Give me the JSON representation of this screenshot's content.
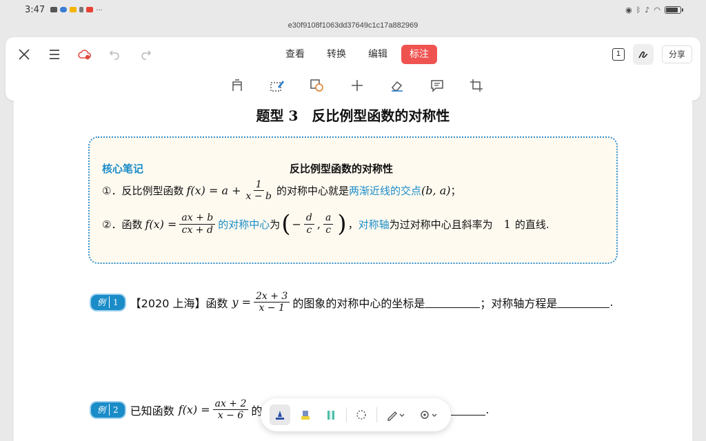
{
  "status_bar": {
    "time": "3:47",
    "battery_level": 0.9
  },
  "file_name": "e30f9108f1063dd37649c1c17a882969",
  "toolbar": {
    "tabs": [
      {
        "label": "查看",
        "active": false
      },
      {
        "label": "转换",
        "active": false
      },
      {
        "label": "编辑",
        "active": false
      },
      {
        "label": "标注",
        "active": true
      }
    ],
    "page_indicator": "1",
    "share_label": "分享",
    "accent_color": "#ef5350"
  },
  "document": {
    "title": "题型 3　反比例型函数的对称性",
    "note": {
      "label": "核心笔记",
      "heading": "反比例型函数的对称性",
      "item1": {
        "prefix": "①．反比例型函数",
        "fx": "f(x) = a +",
        "frac_num": "1",
        "frac_den": "x − b",
        "mid": "的对称中心就是",
        "highlight": "两渐近线的交点",
        "point": "(b, a)",
        "end": "；"
      },
      "item2": {
        "prefix": "②．函数",
        "fx": "f(x) =",
        "frac_num": "ax + b",
        "frac_den": "cx + d",
        "highlight1": "的对称中心",
        "mid1": "为",
        "minus": "−",
        "c1_num": "d",
        "c1_den": "c",
        "comma": ",",
        "c2_num": "a",
        "c2_den": "c",
        "sep": "，",
        "highlight2": "对称轴",
        "mid2": "为过对称中心且斜率为",
        "slope": "1",
        "end": "的直线."
      }
    },
    "example1": {
      "badge_a": "例",
      "badge_b": "1",
      "source": "【2020 上海】函数",
      "y_eq": "y =",
      "frac_num": "2x + 3",
      "frac_den": "x − 1",
      "text1": "的图象的对称中心的坐标是",
      "text2": "；对称轴方程是",
      "end": "."
    },
    "example2": {
      "badge_a": "例",
      "badge_b": "2",
      "text": "已知函数",
      "fx": "f(x) =",
      "frac_num": "ax + 2",
      "frac_den": "x − 6",
      "trail": "的",
      "end": "."
    }
  },
  "pen_toolbar": {
    "tools": [
      "pen-icon",
      "highlighter-icon",
      "marker-icon",
      "lasso-icon",
      "pen-style-icon",
      "settings-icon"
    ]
  }
}
